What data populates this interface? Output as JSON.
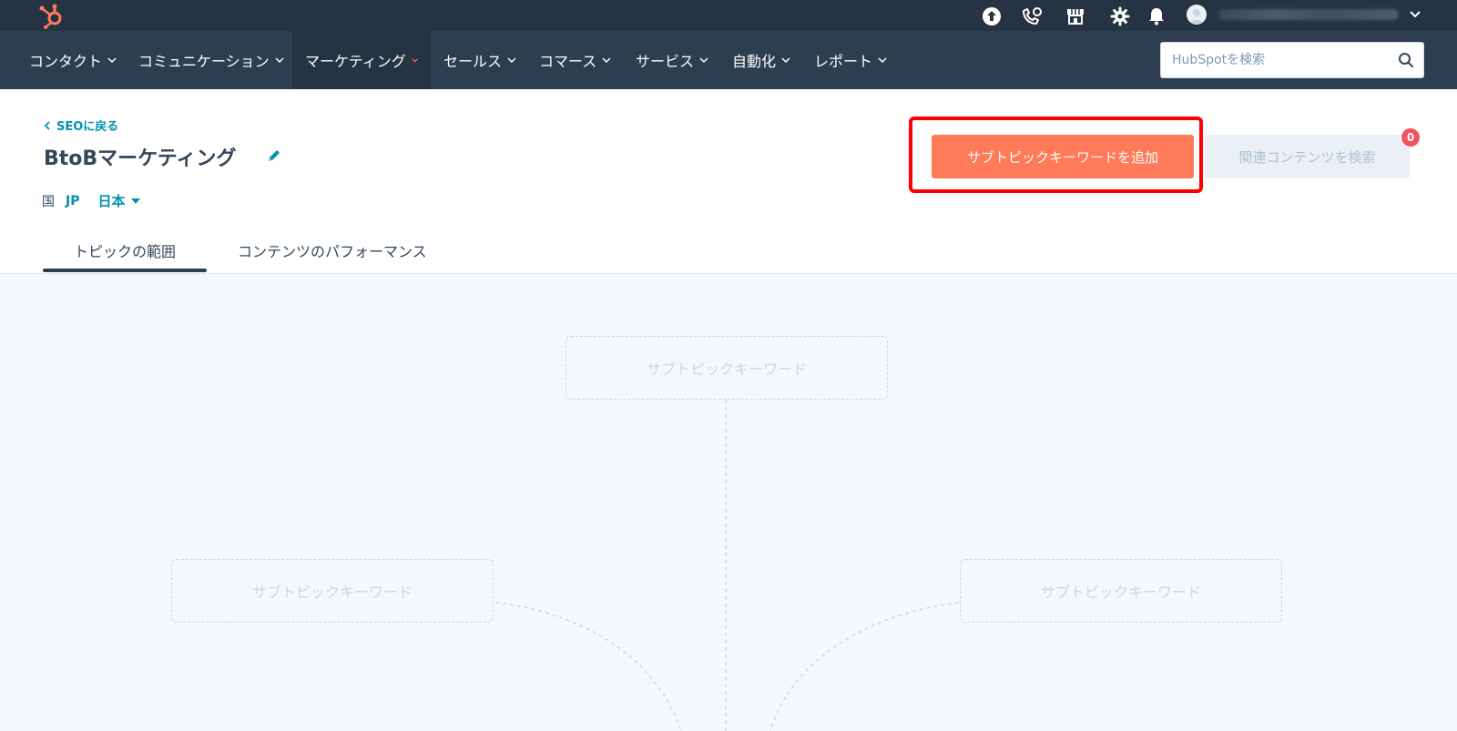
{
  "topbar": {
    "icons": [
      "hubspot-logo-icon",
      "upgrade-icon",
      "calling-icon",
      "marketplace-icon",
      "settings-icon",
      "notifications-icon"
    ],
    "brand_color": "#ff7a59"
  },
  "nav": {
    "items": [
      {
        "label": "コンタクト"
      },
      {
        "label": "コミュニケーション"
      },
      {
        "label": "マーケティング"
      },
      {
        "label": "セールス"
      },
      {
        "label": "コマース"
      },
      {
        "label": "サービス"
      },
      {
        "label": "自動化"
      },
      {
        "label": "レポート"
      }
    ],
    "active_index": 2,
    "search_placeholder": "HubSpotを検索"
  },
  "header": {
    "back_label": "SEOに戻る",
    "title": "BtoBマーケティング",
    "country_label": "国",
    "country_code": "JP",
    "country_name": "日本",
    "primary_button": "サブトピックキーワードを追加",
    "secondary_button": "関連コンテンツを検索",
    "badge_count": "0",
    "highlight_color": "#ff0000"
  },
  "tabs": [
    {
      "label": "トピックの範囲",
      "active": true
    },
    {
      "label": "コンテンツのパフォーマンス",
      "active": false
    }
  ],
  "canvas": {
    "nodes": [
      {
        "label": "サブトピックキーワード"
      },
      {
        "label": "サブトピックキーワード"
      },
      {
        "label": "サブトピックキーワード"
      }
    ]
  }
}
